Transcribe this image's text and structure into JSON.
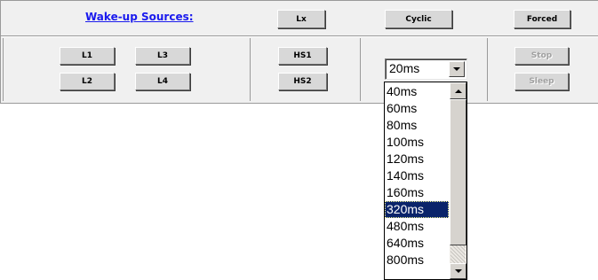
{
  "header": {
    "wakeup_link": "Wake-up Sources:",
    "lx_button": "Lx",
    "cyclic_button": "Cyclic",
    "forced_button": "Forced"
  },
  "sources": {
    "l1": "L1",
    "l2": "L2",
    "l3": "L3",
    "l4": "L4",
    "hs1": "HS1",
    "hs2": "HS2"
  },
  "cyclic_select": {
    "current_value": "20ms",
    "options": [
      "40ms",
      "60ms",
      "80ms",
      "100ms",
      "120ms",
      "140ms",
      "160ms",
      "320ms",
      "480ms",
      "640ms",
      "800ms"
    ],
    "highlighted": "320ms"
  },
  "actions": {
    "stop_button": "Stop",
    "sleep_button": "Sleep",
    "disabled": true
  },
  "colors": {
    "link": "#1a1aee",
    "panel_bg": "#f0f0f0",
    "selection_bg": "#0a246a"
  }
}
